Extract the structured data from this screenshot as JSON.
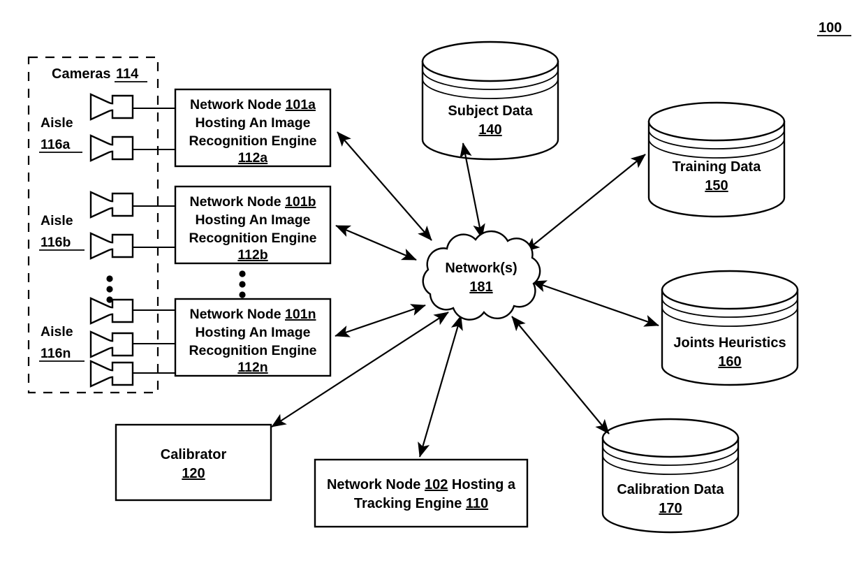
{
  "figure": {
    "reference_number": "100"
  },
  "cameras_group": {
    "title": "Cameras",
    "title_ref": "114",
    "aisles": [
      {
        "label": "Aisle",
        "ref": "116a",
        "camera_count": 2
      },
      {
        "label": "Aisle",
        "ref": "116b",
        "camera_count": 2
      },
      {
        "label": "Aisle",
        "ref": "116n",
        "camera_count": 3
      }
    ],
    "ellipsis": "vertical-dots"
  },
  "network_nodes": [
    {
      "line1_prefix": "Network Node ",
      "line1_ref": "101a",
      "line2": "Hosting An Image",
      "line3": "Recognition Engine",
      "line4_ref": "112a"
    },
    {
      "line1_prefix": "Network Node ",
      "line1_ref": "101b",
      "line2": "Hosting An Image",
      "line3": "Recognition Engine",
      "line4_ref": "112b"
    },
    {
      "line1_prefix": "Network Node ",
      "line1_ref": "101n",
      "line2": "Hosting An Image",
      "line3": "Recognition Engine",
      "line4_ref": "112n"
    }
  ],
  "cloud": {
    "label": "Network(s)",
    "ref": "181"
  },
  "databases": [
    {
      "name": "subject-data",
      "label": "Subject Data",
      "ref": "140"
    },
    {
      "name": "training-data",
      "label": "Training Data",
      "ref": "150"
    },
    {
      "name": "joints-heuristics",
      "label": "Joints Heuristics",
      "ref": "160"
    },
    {
      "name": "calibration-data",
      "label": "Calibration Data",
      "ref": "170"
    }
  ],
  "calibrator": {
    "label": "Calibrator",
    "ref": "120"
  },
  "tracking_node": {
    "line1_prefix": "Network Node ",
    "line1_ref": "102",
    "line1_suffix": " Hosting a",
    "line2_prefix": "Tracking Engine ",
    "line2_ref": "110"
  },
  "colors": {
    "stroke": "#000000",
    "background": "#ffffff"
  }
}
